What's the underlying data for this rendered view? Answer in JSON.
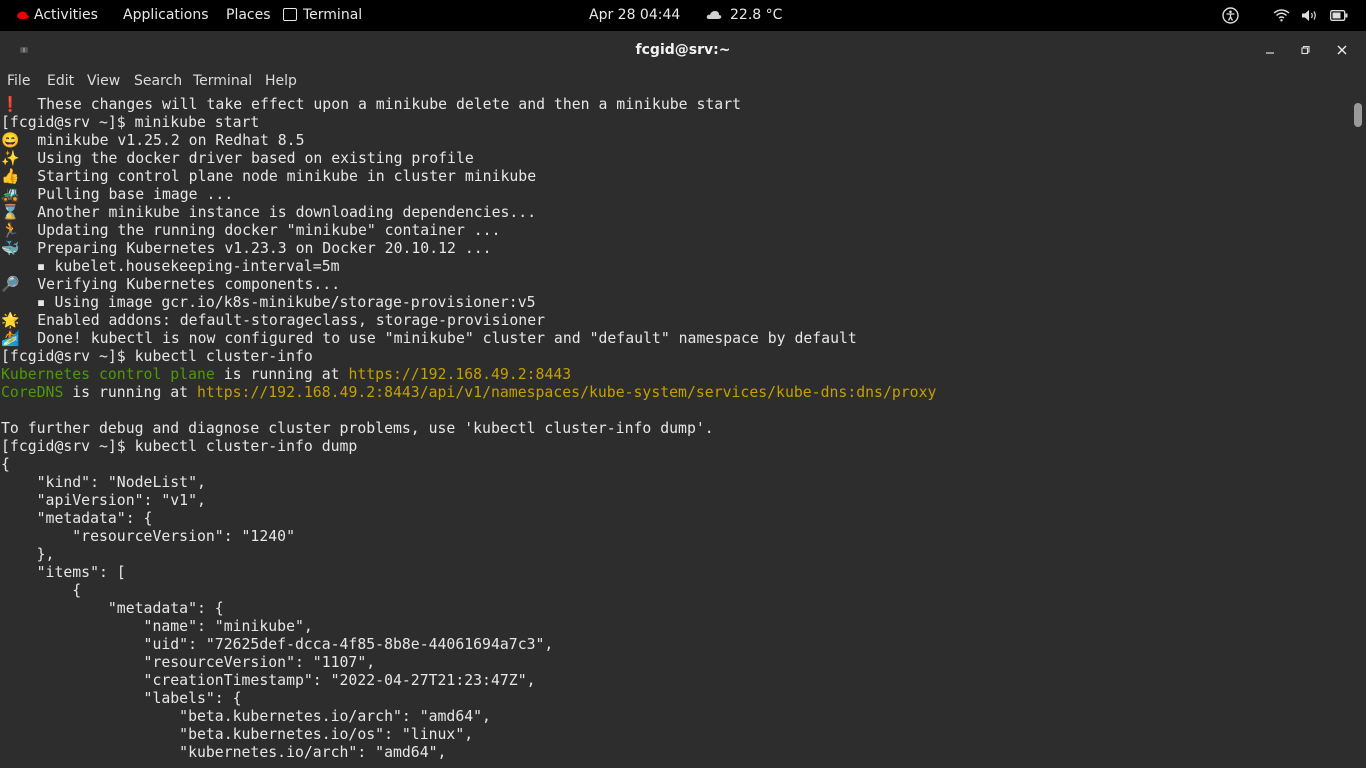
{
  "topbar": {
    "activities": "Activities",
    "applications": "Applications",
    "places": "Places",
    "terminal": "Terminal",
    "clock": "Apr 28  04:44",
    "weather": "22.8 °C"
  },
  "window": {
    "title": "fcgid@srv:~"
  },
  "menubar": {
    "file": "File",
    "edit": "Edit",
    "view": "View",
    "search": "Search",
    "terminal": "Terminal",
    "help": "Help"
  },
  "terminal": {
    "lines": [
      [
        {
          "t": "❗  These changes will take effect upon a minikube delete and then a minikube start"
        }
      ],
      [
        {
          "t": "[fcgid@srv ~]$ minikube start"
        }
      ],
      [
        {
          "t": "😄  minikube v1.25.2 on Redhat 8.5"
        }
      ],
      [
        {
          "t": "✨  Using the docker driver based on existing profile"
        }
      ],
      [
        {
          "t": "👍  Starting control plane node minikube in cluster minikube"
        }
      ],
      [
        {
          "t": "🚜  Pulling base image ..."
        }
      ],
      [
        {
          "t": "⌛  Another minikube instance is downloading dependencies..."
        }
      ],
      [
        {
          "t": "🏃  Updating the running docker \"minikube\" container ..."
        }
      ],
      [
        {
          "t": "🐳  Preparing Kubernetes v1.23.3 on Docker 20.10.12 ..."
        }
      ],
      [
        {
          "t": "    ▪ kubelet.housekeeping-interval=5m"
        }
      ],
      [
        {
          "t": "🔎  Verifying Kubernetes components..."
        }
      ],
      [
        {
          "t": "    ▪ Using image gcr.io/k8s-minikube/storage-provisioner:v5"
        }
      ],
      [
        {
          "t": "🌟  Enabled addons: default-storageclass, storage-provisioner"
        }
      ],
      [
        {
          "t": "🏄  Done! kubectl is now configured to use \"minikube\" cluster and \"default\" namespace by default"
        }
      ],
      [
        {
          "t": "[fcgid@srv ~]$ kubectl cluster-info"
        }
      ],
      [
        {
          "t": "Kubernetes control plane",
          "c": "g"
        },
        {
          "t": " is running at "
        },
        {
          "t": "https://192.168.49.2:8443",
          "c": "y"
        }
      ],
      [
        {
          "t": "CoreDNS",
          "c": "g"
        },
        {
          "t": " is running at "
        },
        {
          "t": "https://192.168.49.2:8443/api/v1/namespaces/kube-system/services/kube-dns:dns/proxy",
          "c": "y"
        }
      ],
      [
        {
          "t": ""
        }
      ],
      [
        {
          "t": "To further debug and diagnose cluster problems, use 'kubectl cluster-info dump'."
        }
      ],
      [
        {
          "t": "[fcgid@srv ~]$ kubectl cluster-info dump"
        }
      ],
      [
        {
          "t": "{"
        }
      ],
      [
        {
          "t": "    \"kind\": \"NodeList\","
        }
      ],
      [
        {
          "t": "    \"apiVersion\": \"v1\","
        }
      ],
      [
        {
          "t": "    \"metadata\": {"
        }
      ],
      [
        {
          "t": "        \"resourceVersion\": \"1240\""
        }
      ],
      [
        {
          "t": "    },"
        }
      ],
      [
        {
          "t": "    \"items\": ["
        }
      ],
      [
        {
          "t": "        {"
        }
      ],
      [
        {
          "t": "            \"metadata\": {"
        }
      ],
      [
        {
          "t": "                \"name\": \"minikube\","
        }
      ],
      [
        {
          "t": "                \"uid\": \"72625def-dcca-4f85-8b8e-44061694a7c3\","
        }
      ],
      [
        {
          "t": "                \"resourceVersion\": \"1107\","
        }
      ],
      [
        {
          "t": "                \"creationTimestamp\": \"2022-04-27T21:23:47Z\","
        }
      ],
      [
        {
          "t": "                \"labels\": {"
        }
      ],
      [
        {
          "t": "                    \"beta.kubernetes.io/arch\": \"amd64\","
        }
      ],
      [
        {
          "t": "                    \"beta.kubernetes.io/os\": \"linux\","
        }
      ],
      [
        {
          "t": "                    \"kubernetes.io/arch\": \"amd64\","
        }
      ]
    ]
  },
  "colors": {
    "green": "#4e9a06",
    "yellow": "#c4a000",
    "background": "#2d2d2d"
  }
}
